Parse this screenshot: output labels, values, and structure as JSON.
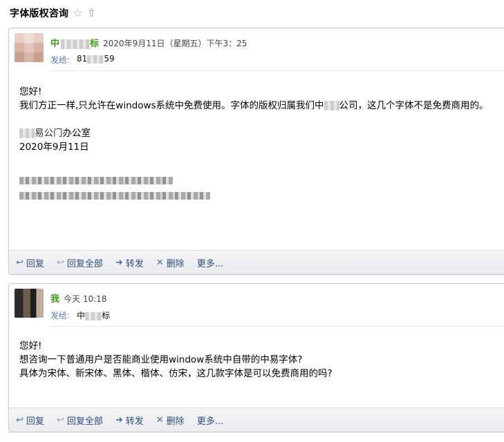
{
  "thread": {
    "title": "字体版权咨询",
    "star_icon": "☆",
    "share_icon": "⇧"
  },
  "messages": [
    {
      "sender": "中",
      "date": "2020年9月11日（星期五）下午3：25",
      "to_label": "发给:",
      "to_value": "81",
      "to_value_suffix": "59",
      "body": {
        "greeting": "您好!",
        "line1_a": "我们方正一样,只允许在windows系统中免费使用。字体的版权归属我们中",
        "line1_b": "公司，这几个字体不是免费商用的。",
        "sign_office": "办公室",
        "sign_date": "2020年9月11日"
      }
    },
    {
      "sender": "我",
      "date": "今天 10:18",
      "to_label": "发给:",
      "to_value": "中",
      "to_value_suffix": "标",
      "body": {
        "line1": "您好!",
        "line2": "想咨询一下普通用户是否能商业使用window系统中自带的中易字体?",
        "line3": "具体为宋体、新宋体、黑体、楷体、仿宋，这几款字体是可以免费商用的吗?"
      }
    }
  ],
  "actions": {
    "reply": "回复",
    "reply_all": "回复全部",
    "forward": "转发",
    "delete": "删除",
    "more": "更多..."
  }
}
